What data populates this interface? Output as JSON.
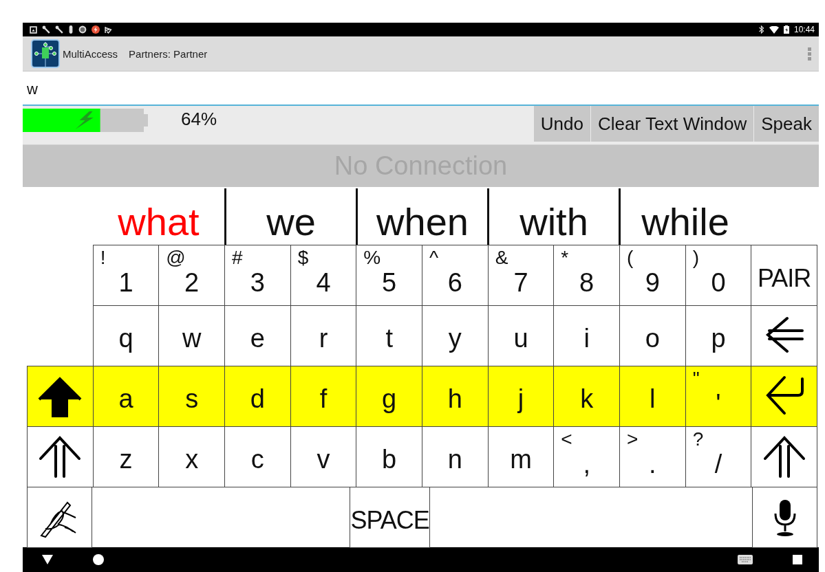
{
  "status_bar": {
    "time": "10:44"
  },
  "app_bar": {
    "title": "MultiAccess",
    "subtitle": "Partners: Partner"
  },
  "text_field": {
    "value": "w"
  },
  "battery": {
    "level": 0.64,
    "reading": "64%",
    "charging": true
  },
  "actions": [
    "Undo",
    "Clear Text Window",
    "Speak"
  ],
  "connection_status": "No Connection",
  "predictions": [
    {
      "word": "what",
      "selected": true
    },
    {
      "word": "we",
      "selected": false
    },
    {
      "word": "when",
      "selected": false
    },
    {
      "word": "with",
      "selected": false
    },
    {
      "word": "while",
      "selected": false
    }
  ],
  "keyboard": {
    "rows": [
      {
        "highlighted": false,
        "keys": [
          {
            "kind": "blank"
          },
          {
            "kind": "char",
            "label": "1",
            "shift": "!"
          },
          {
            "kind": "char",
            "label": "2",
            "shift": "@"
          },
          {
            "kind": "char",
            "label": "3",
            "shift": "#"
          },
          {
            "kind": "char",
            "label": "4",
            "shift": "$"
          },
          {
            "kind": "char",
            "label": "5",
            "shift": "%"
          },
          {
            "kind": "char",
            "label": "6",
            "shift": "^"
          },
          {
            "kind": "char",
            "label": "7",
            "shift": "&"
          },
          {
            "kind": "char",
            "label": "8",
            "shift": "*"
          },
          {
            "kind": "char",
            "label": "9",
            "shift": "("
          },
          {
            "kind": "char",
            "label": "0",
            "shift": ")"
          },
          {
            "kind": "word",
            "label": "PAIR"
          }
        ]
      },
      {
        "highlighted": false,
        "keys": [
          {
            "kind": "blank"
          },
          {
            "kind": "char",
            "label": "q"
          },
          {
            "kind": "char",
            "label": "w"
          },
          {
            "kind": "char",
            "label": "e"
          },
          {
            "kind": "char",
            "label": "r"
          },
          {
            "kind": "char",
            "label": "t"
          },
          {
            "kind": "char",
            "label": "y"
          },
          {
            "kind": "char",
            "label": "u"
          },
          {
            "kind": "char",
            "label": "i"
          },
          {
            "kind": "char",
            "label": "o"
          },
          {
            "kind": "char",
            "label": "p"
          },
          {
            "kind": "backspace"
          }
        ]
      },
      {
        "highlighted": true,
        "keys": [
          {
            "kind": "capslock"
          },
          {
            "kind": "char",
            "label": "a"
          },
          {
            "kind": "char",
            "label": "s"
          },
          {
            "kind": "char",
            "label": "d"
          },
          {
            "kind": "char",
            "label": "f"
          },
          {
            "kind": "char",
            "label": "g"
          },
          {
            "kind": "char",
            "label": "h"
          },
          {
            "kind": "char",
            "label": "j"
          },
          {
            "kind": "char",
            "label": "k"
          },
          {
            "kind": "char",
            "label": "l"
          },
          {
            "kind": "char",
            "label": "'",
            "shift": "\""
          },
          {
            "kind": "enter"
          }
        ]
      },
      {
        "highlighted": false,
        "keys": [
          {
            "kind": "shift"
          },
          {
            "kind": "char",
            "label": "z"
          },
          {
            "kind": "char",
            "label": "x"
          },
          {
            "kind": "char",
            "label": "c"
          },
          {
            "kind": "char",
            "label": "v"
          },
          {
            "kind": "char",
            "label": "b"
          },
          {
            "kind": "char",
            "label": "n"
          },
          {
            "kind": "char",
            "label": "m"
          },
          {
            "kind": "char",
            "label": ",",
            "shift": "<"
          },
          {
            "kind": "char",
            "label": ".",
            "shift": ">"
          },
          {
            "kind": "char",
            "label": "/",
            "shift": "?"
          },
          {
            "kind": "shift"
          }
        ]
      },
      {
        "highlighted": false,
        "keys": [
          {
            "kind": "handwriting"
          },
          {
            "kind": "blank"
          },
          {
            "kind": "blank"
          },
          {
            "kind": "blank"
          },
          {
            "kind": "blank"
          },
          {
            "kind": "word",
            "label": "SPACE"
          },
          {
            "kind": "blank"
          },
          {
            "kind": "blank"
          },
          {
            "kind": "blank"
          },
          {
            "kind": "blank"
          },
          {
            "kind": "blank"
          },
          {
            "kind": "mic"
          }
        ]
      }
    ]
  }
}
